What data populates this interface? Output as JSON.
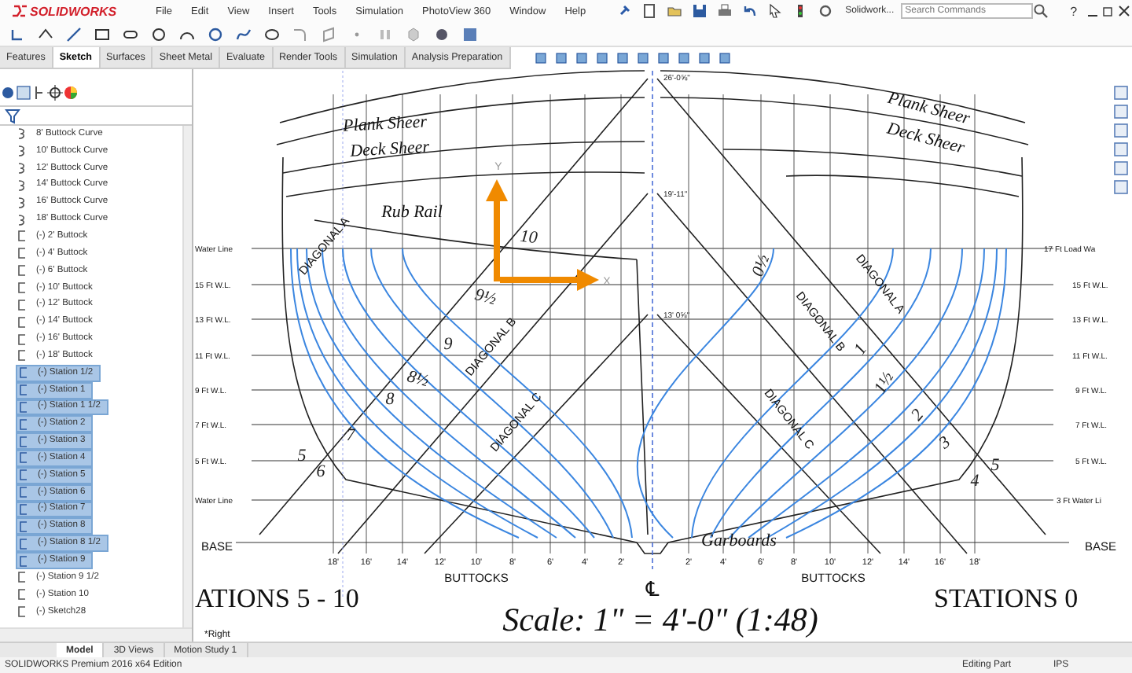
{
  "app": {
    "logo": "SOLIDWORKS",
    "document": "Solidwork...",
    "help": "?"
  },
  "menu": [
    "File",
    "Edit",
    "View",
    "Insert",
    "Tools",
    "Simulation",
    "PhotoView 360",
    "Window",
    "Help"
  ],
  "search": {
    "placeholder": "Search Commands"
  },
  "tabs": [
    {
      "label": "Features",
      "selected": false
    },
    {
      "label": "Sketch",
      "selected": true
    },
    {
      "label": "Surfaces",
      "selected": false
    },
    {
      "label": "Sheet Metal",
      "selected": false
    },
    {
      "label": "Evaluate",
      "selected": false
    },
    {
      "label": "Render Tools",
      "selected": false
    },
    {
      "label": "Simulation",
      "selected": false
    },
    {
      "label": "Analysis Preparation",
      "selected": false
    }
  ],
  "tree": [
    {
      "label": "8' Buttock Curve",
      "kind": "curve",
      "selected": false
    },
    {
      "label": "10' Buttock Curve",
      "kind": "curve",
      "selected": false
    },
    {
      "label": "12' Buttock Curve",
      "kind": "curve",
      "selected": false
    },
    {
      "label": "14' Buttock Curve",
      "kind": "curve",
      "selected": false
    },
    {
      "label": "16' Buttock Curve",
      "kind": "curve",
      "selected": false
    },
    {
      "label": "18' Buttock Curve",
      "kind": "curve",
      "selected": false
    },
    {
      "label": "(-) 2' Buttock",
      "kind": "sketch",
      "selected": false
    },
    {
      "label": "(-) 4' Buttock",
      "kind": "sketch",
      "selected": false
    },
    {
      "label": "(-) 6' Buttock",
      "kind": "sketch",
      "selected": false
    },
    {
      "label": "(-) 10' Buttock",
      "kind": "sketch",
      "selected": false
    },
    {
      "label": "(-) 12' Buttock",
      "kind": "sketch",
      "selected": false
    },
    {
      "label": "(-) 14' Buttock",
      "kind": "sketch",
      "selected": false
    },
    {
      "label": "(-) 16' Buttock",
      "kind": "sketch",
      "selected": false
    },
    {
      "label": "(-) 18' Buttock",
      "kind": "sketch",
      "selected": false
    },
    {
      "label": "(-) Station 1/2",
      "kind": "sketch",
      "selected": true
    },
    {
      "label": "(-) Station 1",
      "kind": "sketch",
      "selected": true
    },
    {
      "label": "(-) Station 1 1/2",
      "kind": "sketch",
      "selected": true
    },
    {
      "label": "(-) Station 2",
      "kind": "sketch",
      "selected": true
    },
    {
      "label": "(-) Station 3",
      "kind": "sketch",
      "selected": true
    },
    {
      "label": "(-) Station 4",
      "kind": "sketch",
      "selected": true
    },
    {
      "label": "(-) Station 5",
      "kind": "sketch",
      "selected": true
    },
    {
      "label": "(-) Station 6",
      "kind": "sketch",
      "selected": true
    },
    {
      "label": "(-) Station 7",
      "kind": "sketch",
      "selected": true
    },
    {
      "label": "(-) Station 8",
      "kind": "sketch",
      "selected": true
    },
    {
      "label": "(-) Station 8 1/2",
      "kind": "sketch",
      "selected": true
    },
    {
      "label": "(-) Station 9",
      "kind": "sketch",
      "selected": true
    },
    {
      "label": "(-) Station 9 1/2",
      "kind": "sketch",
      "selected": false
    },
    {
      "label": "(-) Station 10",
      "kind": "sketch",
      "selected": false
    },
    {
      "label": "(-) Sketch28",
      "kind": "sketch",
      "selected": false
    }
  ],
  "canvas": {
    "labels": [
      {
        "text": "Plank Sheer",
        "kind": "note"
      },
      {
        "text": "Deck Sheer",
        "kind": "note"
      },
      {
        "text": "Rub Rail",
        "kind": "note"
      },
      {
        "text": "10",
        "kind": "station"
      },
      {
        "text": "9½",
        "kind": "station"
      },
      {
        "text": "9",
        "kind": "station"
      },
      {
        "text": "8½",
        "kind": "station"
      },
      {
        "text": "8",
        "kind": "station"
      },
      {
        "text": "7",
        "kind": "station"
      },
      {
        "text": "5",
        "kind": "station"
      },
      {
        "text": "6",
        "kind": "station"
      },
      {
        "text": "DIAGONAL A",
        "kind": "diagonal"
      },
      {
        "text": "DIAGONAL B",
        "kind": "diagonal"
      },
      {
        "text": "DIAGONAL C",
        "kind": "diagonal"
      },
      {
        "text": "Plank Sheer",
        "kind": "note"
      },
      {
        "text": "Deck Sheer",
        "kind": "note"
      },
      {
        "text": "0½",
        "kind": "station"
      },
      {
        "text": "1",
        "kind": "station"
      },
      {
        "text": "1½",
        "kind": "station"
      },
      {
        "text": "2",
        "kind": "station"
      },
      {
        "text": "3",
        "kind": "station"
      },
      {
        "text": "5",
        "kind": "station"
      },
      {
        "text": "4",
        "kind": "station"
      },
      {
        "text": "DIAGONAL A",
        "kind": "diagonal"
      },
      {
        "text": "DIAGONAL B",
        "kind": "diagonal"
      },
      {
        "text": "DIAGONAL C",
        "kind": "diagonal"
      },
      {
        "text": "Garboards",
        "kind": "note"
      },
      {
        "text": "Y",
        "kind": "axis"
      },
      {
        "text": "X",
        "kind": "axis"
      },
      {
        "text": "26'-0⅝\"",
        "kind": "dimension"
      },
      {
        "text": "19'-11\"",
        "kind": "dimension"
      },
      {
        "text": "13' 0⅝\"",
        "kind": "dimension"
      },
      {
        "text": "Water Line",
        "kind": "waterline"
      },
      {
        "text": "15 Ft W.L.",
        "kind": "waterline"
      },
      {
        "text": "13 Ft W.L.",
        "kind": "waterline"
      },
      {
        "text": "11 Ft W.L.",
        "kind": "waterline"
      },
      {
        "text": "9 Ft W.L.",
        "kind": "waterline"
      },
      {
        "text": "7 Ft W.L.",
        "kind": "waterline"
      },
      {
        "text": "5 Ft W.L.",
        "kind": "waterline"
      },
      {
        "text": "Water Line",
        "kind": "waterline"
      },
      {
        "text": "BASE",
        "kind": "base"
      },
      {
        "text": "17 Ft Load Wa",
        "kind": "waterline"
      },
      {
        "text": "15 Ft W.L.",
        "kind": "waterline"
      },
      {
        "text": "13 Ft W.L.",
        "kind": "waterline"
      },
      {
        "text": "11 Ft W.L.",
        "kind": "waterline"
      },
      {
        "text": "9 Ft W.L.",
        "kind": "waterline"
      },
      {
        "text": "7 Ft W.L.",
        "kind": "waterline"
      },
      {
        "text": "5 Ft W.L.",
        "kind": "waterline"
      },
      {
        "text": "3 Ft Water Li",
        "kind": "waterline"
      },
      {
        "text": "BASE",
        "kind": "base"
      },
      {
        "text": "18'",
        "kind": "tick"
      },
      {
        "text": "16'",
        "kind": "tick"
      },
      {
        "text": "14'",
        "kind": "tick"
      },
      {
        "text": "12'",
        "kind": "tick"
      },
      {
        "text": "10'",
        "kind": "tick"
      },
      {
        "text": "8'",
        "kind": "tick"
      },
      {
        "text": "6'",
        "kind": "tick"
      },
      {
        "text": "4'",
        "kind": "tick"
      },
      {
        "text": "2'",
        "kind": "tick"
      },
      {
        "text": "2'",
        "kind": "tick"
      },
      {
        "text": "4'",
        "kind": "tick"
      },
      {
        "text": "6'",
        "kind": "tick"
      },
      {
        "text": "8'",
        "kind": "tick"
      },
      {
        "text": "10'",
        "kind": "tick"
      },
      {
        "text": "12'",
        "kind": "tick"
      },
      {
        "text": "14'",
        "kind": "tick"
      },
      {
        "text": "16'",
        "kind": "tick"
      },
      {
        "text": "18'",
        "kind": "tick"
      },
      {
        "text": "BUTTOCKS",
        "kind": "base"
      },
      {
        "text": "BUTTOCKS",
        "kind": "base"
      },
      {
        "text": "℄",
        "kind": "centerline"
      },
      {
        "text": "ATIONS 5 - 10",
        "kind": "heading"
      },
      {
        "text": "STATIONS 0",
        "kind": "heading"
      },
      {
        "text": "*Right",
        "kind": "view"
      },
      {
        "text": "Scale: 1\" = 4'-0\" (1:48)",
        "kind": "scale"
      }
    ]
  },
  "bottom_tabs": [
    {
      "label": "Model",
      "selected": true
    },
    {
      "label": "3D Views",
      "selected": false
    },
    {
      "label": "Motion Study 1",
      "selected": false
    }
  ],
  "status_bar": {
    "edition": "SOLIDWORKS Premium 2016 x64 Edition",
    "mode": "Editing Part",
    "units": "IPS"
  }
}
